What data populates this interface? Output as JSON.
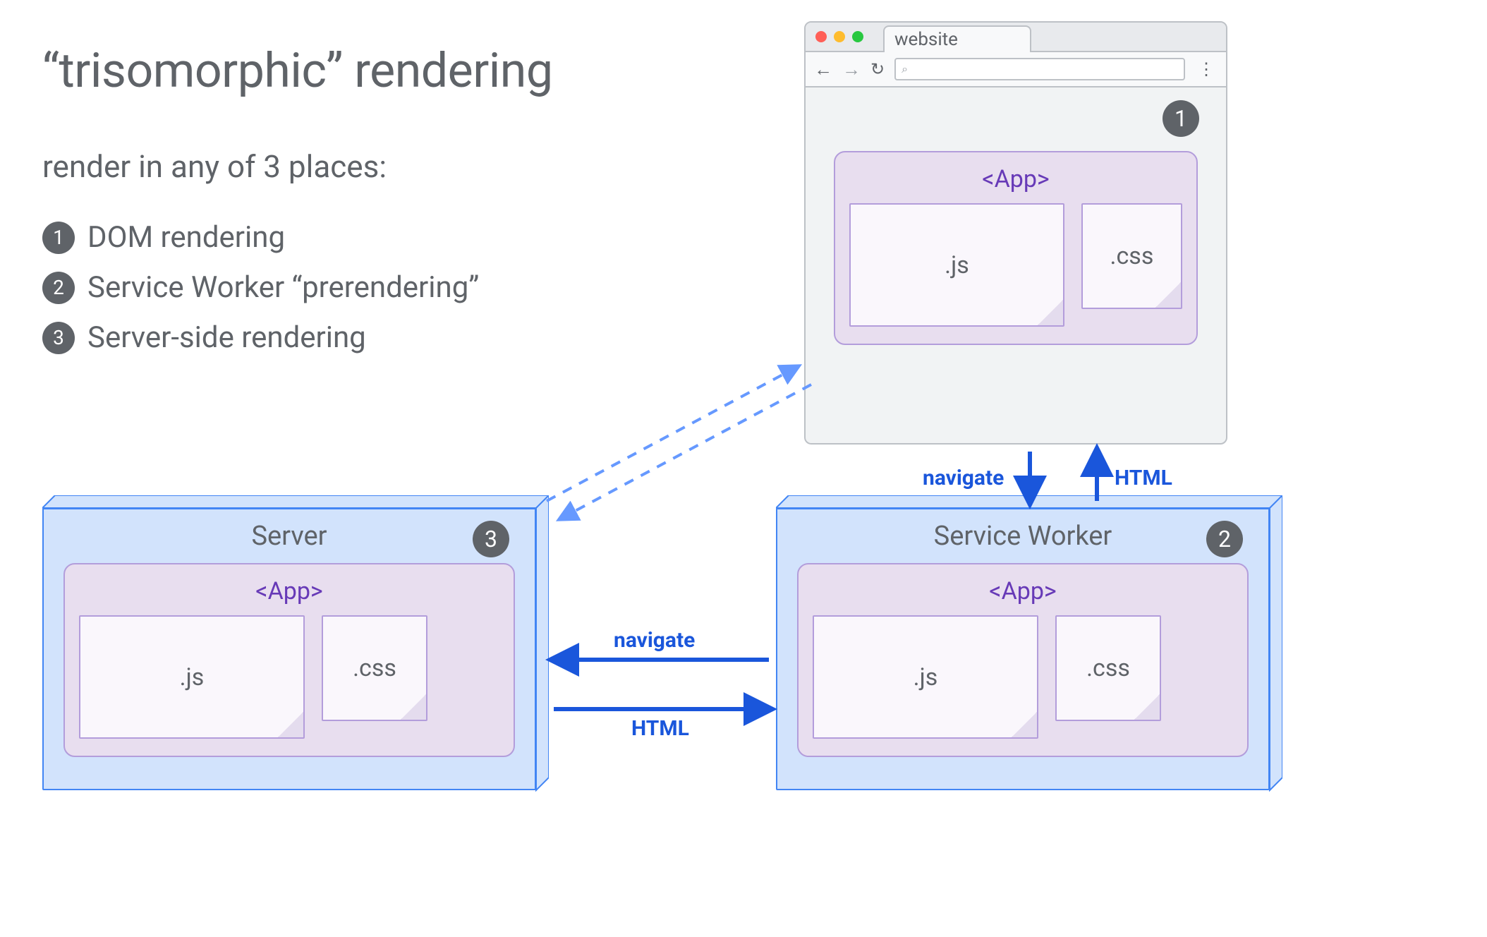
{
  "title": "“trisomorphic” rendering",
  "subtitle": "render in any of 3 places:",
  "bullets": [
    {
      "n": "1",
      "text": "DOM rendering"
    },
    {
      "n": "2",
      "text": "Service Worker “prerendering”"
    },
    {
      "n": "3",
      "text": "Server-side rendering"
    }
  ],
  "browser": {
    "tab": "website",
    "badge": "1",
    "search_icon": "⌕",
    "app_label": "<App>",
    "file_js": ".js",
    "file_css": ".css"
  },
  "server": {
    "title": "Server",
    "badge": "3",
    "app_label": "<App>",
    "file_js": ".js",
    "file_css": ".css"
  },
  "sw": {
    "title": "Service Worker",
    "badge": "2",
    "app_label": "<App>",
    "file_js": ".js",
    "file_css": ".css"
  },
  "arrows": {
    "navigate": "navigate",
    "html": "HTML"
  },
  "colors": {
    "text": "#5f6368",
    "blue_line": "#1a56db",
    "blue_fill": "#d2e3fc",
    "blue_border": "#4285f4",
    "purple_fill": "#e8deef",
    "purple_border": "#b39ddb",
    "purple_text": "#673ab7",
    "badge_bg": "#5f6368"
  }
}
